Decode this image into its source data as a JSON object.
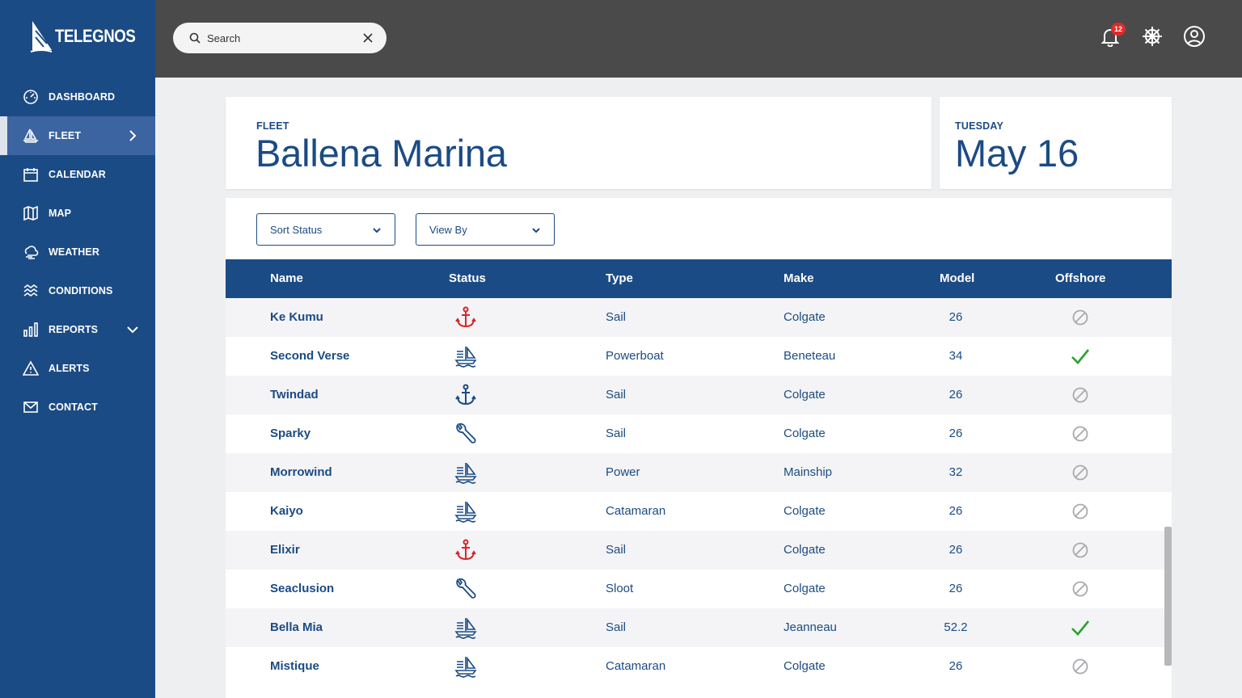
{
  "brand": {
    "name": "TELEGNOS"
  },
  "sidebar": {
    "items": [
      {
        "label": "DASHBOARD",
        "icon": "dashboard-icon"
      },
      {
        "label": "FLEET",
        "icon": "sailboat-icon",
        "active": true,
        "chevron": "right"
      },
      {
        "label": "CALENDAR",
        "icon": "calendar-icon"
      },
      {
        "label": "MAP",
        "icon": "map-icon"
      },
      {
        "label": "WEATHER",
        "icon": "weather-icon"
      },
      {
        "label": "CONDITIONS",
        "icon": "waves-icon"
      },
      {
        "label": "REPORTS",
        "icon": "bar-chart-icon",
        "chevron": "down"
      },
      {
        "label": "ALERTS",
        "icon": "warning-icon"
      },
      {
        "label": "CONTACT",
        "icon": "mail-icon"
      }
    ]
  },
  "topbar": {
    "search": {
      "placeholder": "Search",
      "value": ""
    },
    "notifications_count": "12",
    "icons": [
      "bell-icon",
      "ship-wheel-icon",
      "user-icon"
    ]
  },
  "header": {
    "fleet_label": "FLEET",
    "fleet_name": "Ballena Marina",
    "day_label": "TUESDAY",
    "date": "May 16"
  },
  "filters": {
    "sort": "Sort Status",
    "view": "View By"
  },
  "table": {
    "columns": [
      "Name",
      "Status",
      "Type",
      "Make",
      "Model",
      "Offshore"
    ],
    "rows": [
      {
        "name": "Ke Kumu",
        "status": "anchored-alert",
        "type": "Sail",
        "make": "Colgate",
        "model": "26",
        "offshore": false
      },
      {
        "name": "Second Verse",
        "status": "at-sea",
        "type": "Powerboat",
        "make": "Beneteau",
        "model": "34",
        "offshore": true
      },
      {
        "name": "Twindad",
        "status": "anchored",
        "type": "Sail",
        "make": "Colgate",
        "model": "26",
        "offshore": false
      },
      {
        "name": "Sparky",
        "status": "maintenance",
        "type": "Sail",
        "make": "Colgate",
        "model": "26",
        "offshore": false
      },
      {
        "name": "Morrowind",
        "status": "at-sea",
        "type": "Power",
        "make": "Mainship",
        "model": "32",
        "offshore": false
      },
      {
        "name": "Kaiyo",
        "status": "at-sea",
        "type": "Catamaran",
        "make": "Colgate",
        "model": "26",
        "offshore": false
      },
      {
        "name": "Elixir",
        "status": "anchored-alert",
        "type": "Sail",
        "make": "Colgate",
        "model": "26",
        "offshore": false
      },
      {
        "name": "Seaclusion",
        "status": "maintenance",
        "type": "Sloot",
        "make": "Colgate",
        "model": "26",
        "offshore": false
      },
      {
        "name": "Bella Mia",
        "status": "at-sea",
        "type": "Sail",
        "make": "Jeanneau",
        "model": "52.2",
        "offshore": true
      },
      {
        "name": "Mistique",
        "status": "at-sea",
        "type": "Catamaran",
        "make": "Colgate",
        "model": "26",
        "offshore": false
      }
    ]
  },
  "colors": {
    "sidebar": "#1b4b84",
    "sidebar_active": "#3b64a0",
    "topbar": "#4a4a4a",
    "accent": "#1b4b84",
    "alert": "#d6252b",
    "success": "#2aa32a",
    "muted": "#a9a9ad"
  }
}
